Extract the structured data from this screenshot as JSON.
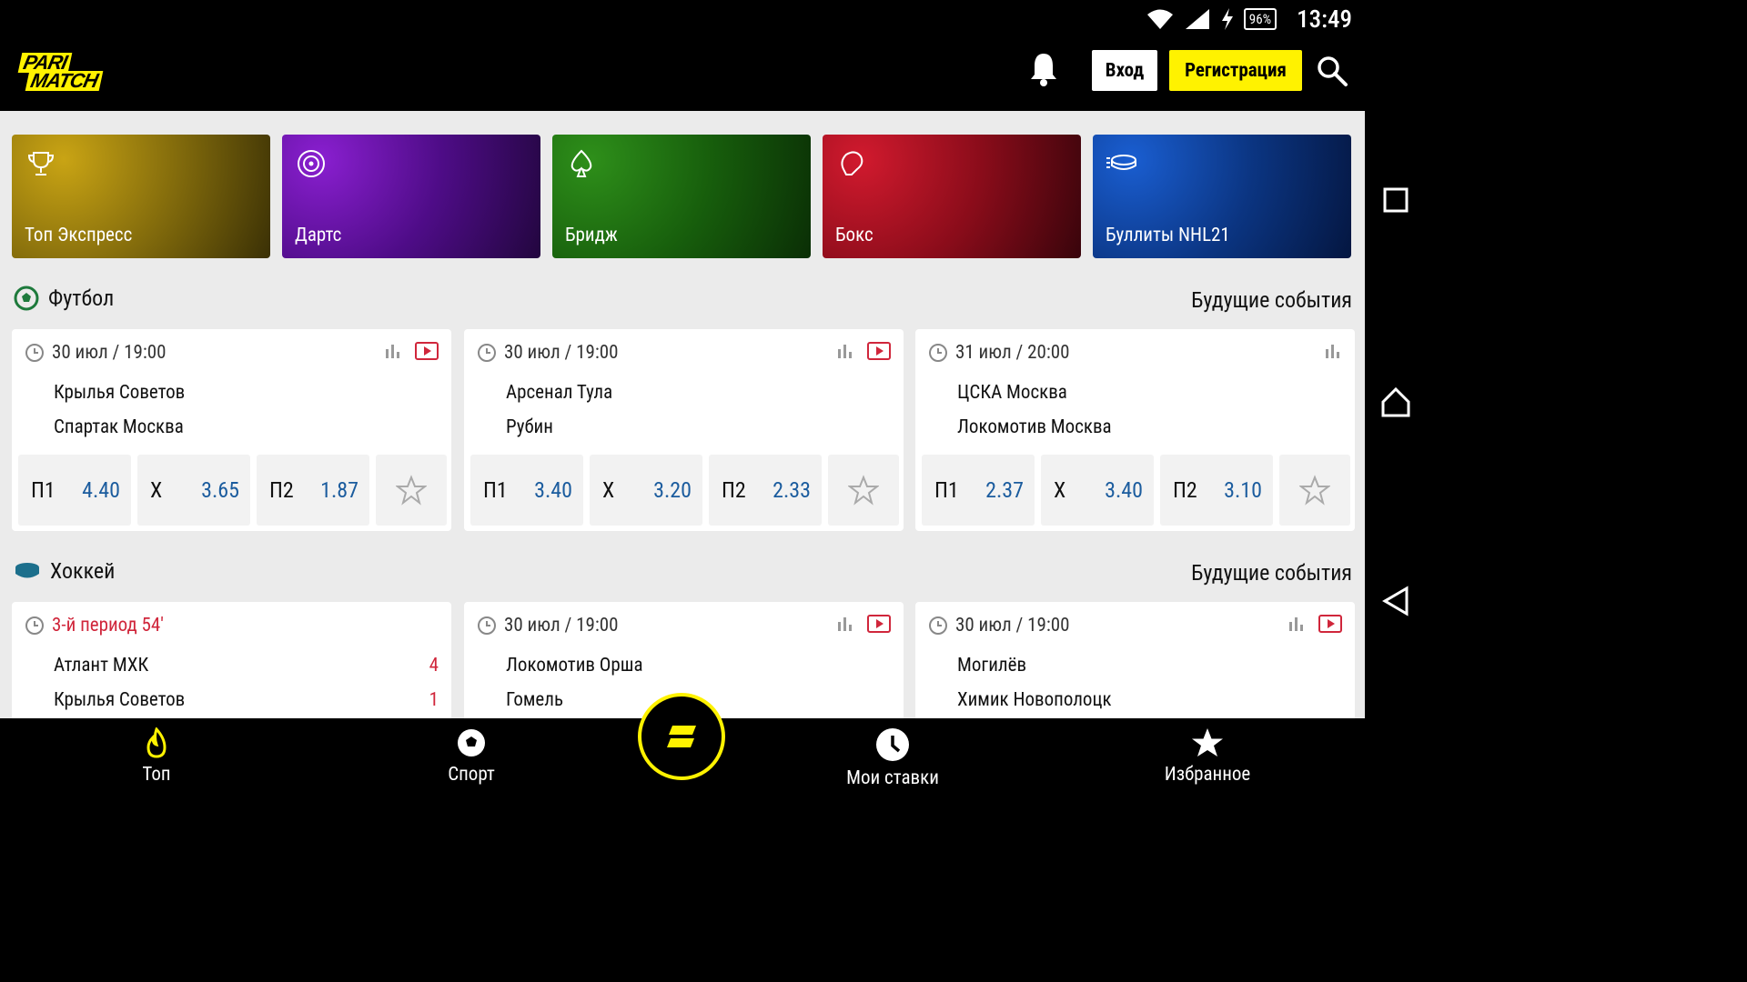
{
  "status_bar": {
    "battery": "96%",
    "time": "13:49",
    "icons": [
      "wifi-icon",
      "signal-icon",
      "charging-icon"
    ]
  },
  "header": {
    "logo": {
      "line1": "PARI",
      "line2": "MATCH"
    },
    "login_label": "Вход",
    "register_label": "Регистрация",
    "icons": [
      "bell-icon",
      "search-icon"
    ]
  },
  "colors": {
    "brand_yellow": "#fff200",
    "odds_blue": "#1b5c9e",
    "live_red": "#d0263b"
  },
  "promos": [
    {
      "label": "Топ Экспресс",
      "icon": "trophy-icon"
    },
    {
      "label": "Дартс",
      "icon": "dartboard-icon"
    },
    {
      "label": "Бридж",
      "icon": "spade-icon"
    },
    {
      "label": "Бокс",
      "icon": "boxing-glove-icon"
    },
    {
      "label": "Буллиты NHL21",
      "icon": "puck-icon"
    }
  ],
  "football": {
    "title": "Футбол",
    "link": "Будущие события",
    "matches": [
      {
        "datetime": "30 июл / 19:00",
        "team1": "Крылья Советов",
        "team2": "Спартак Москва",
        "odds": [
          {
            "label": "П1",
            "value": "4.40"
          },
          {
            "label": "Х",
            "value": "3.65"
          },
          {
            "label": "П2",
            "value": "1.87"
          }
        ]
      },
      {
        "datetime": "30 июл / 19:00",
        "team1": "Арсенал Тула",
        "team2": "Рубин",
        "odds": [
          {
            "label": "П1",
            "value": "3.40"
          },
          {
            "label": "Х",
            "value": "3.20"
          },
          {
            "label": "П2",
            "value": "2.33"
          }
        ]
      },
      {
        "datetime": "31 июл / 20:00",
        "team1": "ЦСКА Москва",
        "team2": "Локомотив Москва",
        "odds": [
          {
            "label": "П1",
            "value": "2.37"
          },
          {
            "label": "Х",
            "value": "3.40"
          },
          {
            "label": "П2",
            "value": "3.10"
          }
        ]
      }
    ]
  },
  "hockey": {
    "title": "Хоккей",
    "link": "Будущие события",
    "matches": [
      {
        "datetime": "3-й период 54'",
        "team1": "Атлант МХК",
        "team2": "Крылья Советов",
        "score1": "4",
        "score2": "1"
      },
      {
        "datetime": "30 июл / 19:00",
        "team1": "Локомотив Орша",
        "team2": "Гомель"
      },
      {
        "datetime": "30 июл / 19:00",
        "team1": "Могилёв",
        "team2": "Химик Новополоцк"
      }
    ]
  },
  "bottom_nav": [
    {
      "label": "Топ",
      "icon": "flame-icon"
    },
    {
      "label": "Спорт",
      "icon": "soccer-ball-icon"
    },
    {
      "label": "Мои ставки",
      "icon": "clock-icon"
    },
    {
      "label": "Избранное",
      "icon": "star-icon"
    }
  ]
}
